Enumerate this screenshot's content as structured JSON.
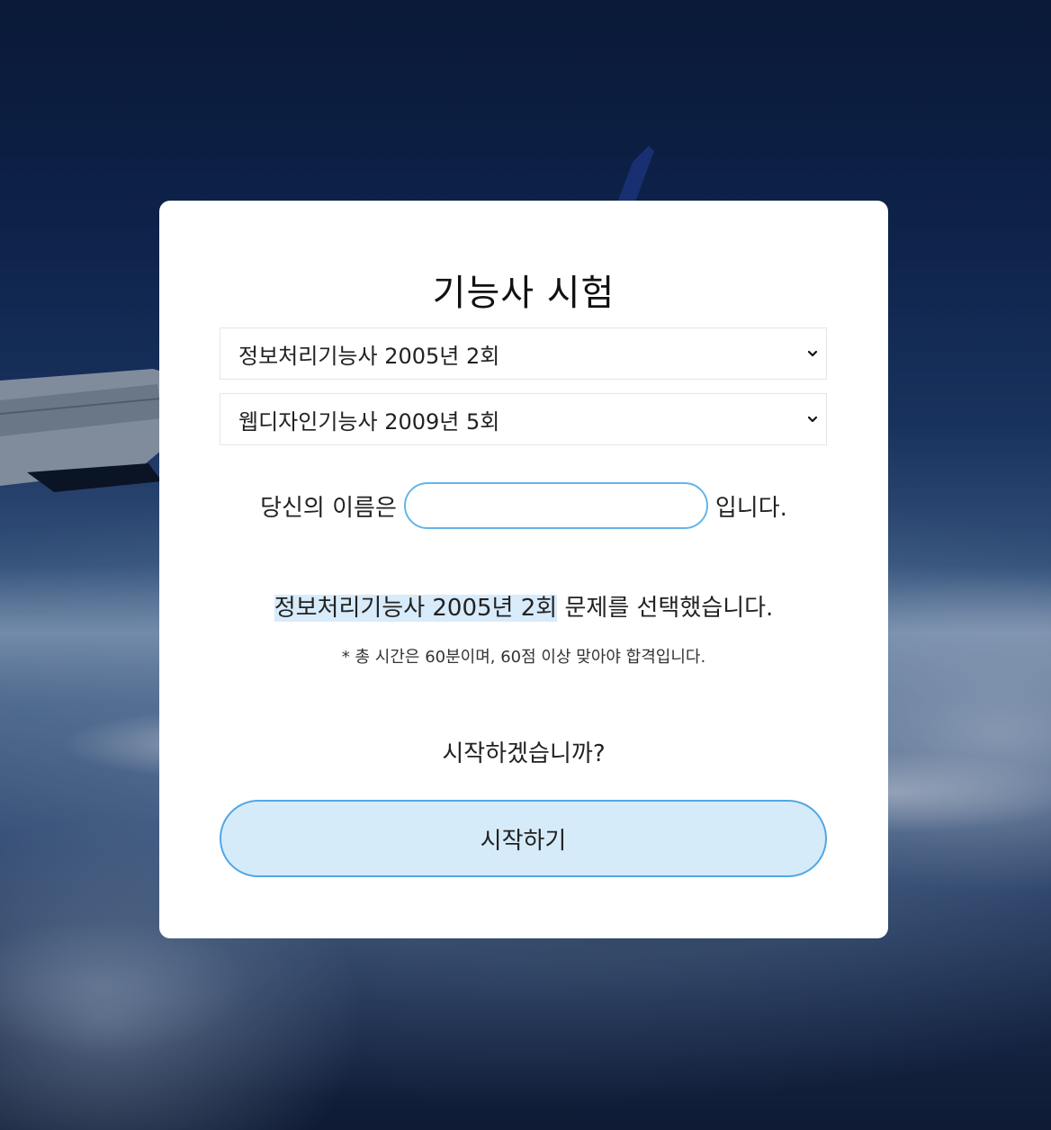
{
  "page": {
    "title": "기능사 시험"
  },
  "exam_select_1": {
    "selected": "정보처리기능사 2005년 2회"
  },
  "exam_select_2": {
    "selected": "웹디자인기능사 2009년 5회"
  },
  "name_row": {
    "prefix": "당신의 이름은",
    "input_value": "",
    "suffix": "입니다."
  },
  "selection_message": {
    "highlighted": "정보처리기능사 2005년 2회",
    "rest": " 문제를 선택했습니다."
  },
  "note": "* 총 시간은 60분이며, 60점 이상 맞아야 합격입니다.",
  "question": "시작하겠습니까?",
  "start_button": {
    "label": "시작하기"
  },
  "colors": {
    "accent_border": "#52a7e2",
    "button_fill": "#d6ebfa",
    "highlight": "#d8ebfa"
  },
  "icons": {
    "select_arrow": "chevron-down-icon"
  }
}
